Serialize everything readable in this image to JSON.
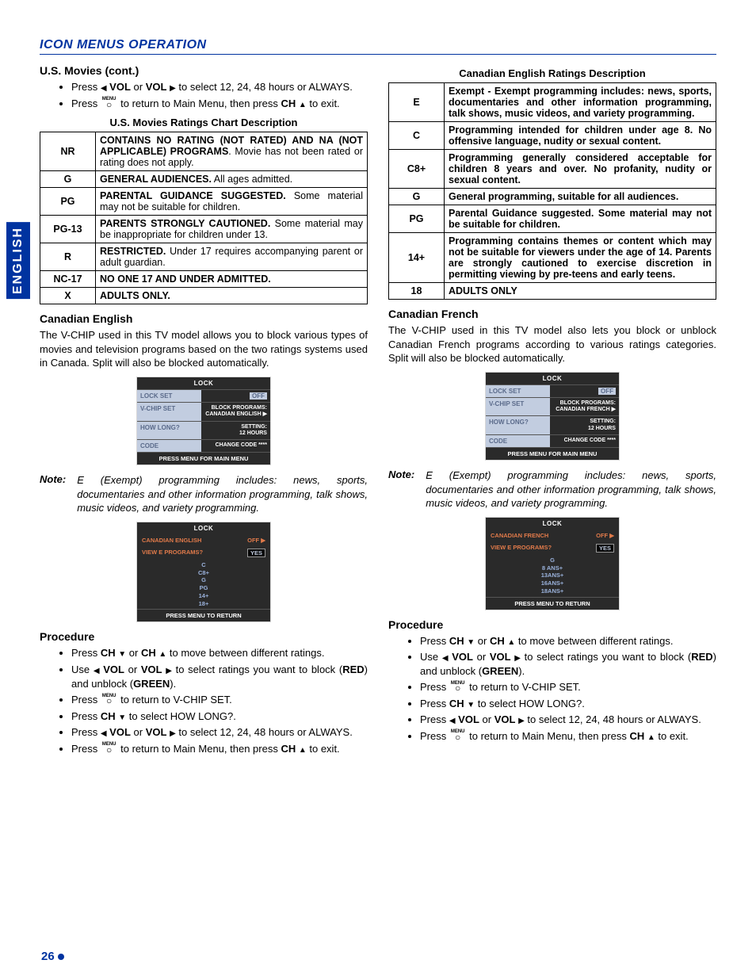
{
  "header": "ICON MENUS OPERATION",
  "side_tab": "ENGLISH",
  "page_number": "26",
  "left": {
    "us_movies_cont": "U.S. Movies (cont.)",
    "bullets_top": [
      "Press ◀ VOL or VOL ▶ to select 12, 24, 48 hours or ALWAYS.",
      "Press [MENU] to return to Main Menu, then press CH ▲ to exit."
    ],
    "chart_title": "U.S. Movies Ratings Chart Description",
    "us_table": [
      {
        "code": "NR",
        "desc": "CONTAINS NO RATING (NOT RATED) AND NA (NOT APPLICABLE) PROGRAMS. Movie has not been rated or rating does not apply.",
        "bold_prefix": "CONTAINS NO RATING (NOT RATED) AND NA (NOT APPLICABLE) PROGRAMS"
      },
      {
        "code": "G",
        "desc": "GENERAL AUDIENCES. All ages admitted.",
        "bold_prefix": "GENERAL AUDIENCES."
      },
      {
        "code": "PG",
        "desc": "PARENTAL GUIDANCE SUGGESTED. Some material may not be suitable for children.",
        "bold_prefix": "PARENTAL GUIDANCE SUGGESTED."
      },
      {
        "code": "PG-13",
        "desc": "PARENTS STRONGLY CAUTIONED. Some material may be inappropriate for children under 13.",
        "bold_prefix": "PARENTS STRONGLY CAUTIONED."
      },
      {
        "code": "R",
        "desc": "RESTRICTED. Under 17 requires accompanying parent or adult guardian.",
        "bold_prefix": "RESTRICTED."
      },
      {
        "code": "NC-17",
        "desc": "NO ONE 17 AND UNDER ADMITTED.",
        "bold_prefix": "NO ONE 17 AND UNDER ADMITTED."
      },
      {
        "code": "X",
        "desc": "ADULTS ONLY.",
        "bold_prefix": "ADULTS ONLY."
      }
    ],
    "can_en_head": "Canadian English",
    "can_en_body": "The V-CHIP used in this TV model allows you to block various types of movies and television programs based on the two ratings systems used in Canada. Split will also be blocked automatically.",
    "osd1": {
      "title": "LOCK",
      "rows": [
        {
          "left": "LOCK SET",
          "right_chip": "OFF"
        },
        {
          "left": "V-CHIP SET",
          "right_lines": [
            "BLOCK PROGRAMS:",
            "CANADIAN ENGLISH ▶"
          ]
        },
        {
          "left": "HOW LONG?",
          "right_lines": [
            "SETTING:",
            "12 HOURS"
          ]
        },
        {
          "left": "CODE",
          "right_lines": [
            "CHANGE CODE  ****"
          ]
        }
      ],
      "footer": "PRESS MENU FOR MAIN MENU"
    },
    "note_label": "Note:",
    "note_text": "E (Exempt) programming includes: news, sports, documentaries and other information programming, talk shows, music videos, and variety programming.",
    "osd2": {
      "title": "LOCK",
      "headrow": {
        "left": "CANADIAN ENGLISH",
        "right": "OFF ▶"
      },
      "row_q": {
        "left": "VIEW E PROGRAMS?",
        "right_chip": "YES"
      },
      "list": [
        "C",
        "C8+",
        "G",
        "PG",
        "14+",
        "18+"
      ],
      "footer": "PRESS MENU TO RETURN"
    },
    "proc_head": "Procedure",
    "procedure": [
      "Press CH ▼ or CH ▲ to move between different ratings.",
      "Use ◀ VOL or VOL ▶ to select ratings you want to block (RED) and unblock (GREEN).",
      "Press [MENU] to return to V-CHIP SET.",
      "Press CH ▼ to select HOW LONG?.",
      "Press ◀ VOL or VOL ▶ to select 12, 24, 48 hours or ALWAYS.",
      "Press [MENU] to return to Main Menu, then press CH ▲ to exit."
    ]
  },
  "right": {
    "can_table_title": "Canadian English Ratings Description",
    "can_table": [
      {
        "code": "E",
        "desc": "Exempt - Exempt programming includes: news, sports, documentaries and other information programming, talk shows, music videos, and variety programming."
      },
      {
        "code": "C",
        "desc": "Programming intended for children under age 8. No offensive language, nudity or sexual content."
      },
      {
        "code": "C8+",
        "desc": "Programming generally considered acceptable for children 8 years and over. No profanity, nudity or sexual content."
      },
      {
        "code": "G",
        "desc": "General programming, suitable for all audiences."
      },
      {
        "code": "PG",
        "desc": "Parental Guidance suggested. Some material may not be suitable for children."
      },
      {
        "code": "14+",
        "desc": "Programming contains themes or content which may not be suitable for viewers under the age of 14. Parents are strongly cautioned to exercise discretion in permitting viewing by pre-teens and early teens."
      },
      {
        "code": "18",
        "desc": "ADULTS ONLY"
      }
    ],
    "can_fr_head": "Canadian French",
    "can_fr_body": "The V-CHIP used in this TV model also lets you block or unblock Canadian French programs according to various ratings categories. Split will also be blocked automatically.",
    "osd1": {
      "title": "LOCK",
      "rows": [
        {
          "left": "LOCK SET",
          "right_chip": "OFF"
        },
        {
          "left": "V-CHIP SET",
          "right_lines": [
            "BLOCK PROGRAMS:",
            "CANADIAN FRENCH ▶"
          ]
        },
        {
          "left": "HOW LONG?",
          "right_lines": [
            "SETTING:",
            "12 HOURS"
          ]
        },
        {
          "left": "CODE",
          "right_lines": [
            "CHANGE CODE  ****"
          ]
        }
      ],
      "footer": "PRESS MENU FOR MAIN MENU"
    },
    "note_label": "Note:",
    "note_text": "E (Exempt) programming includes: news, sports, documentaries and other information programming, talk shows, music videos, and variety programming.",
    "osd2": {
      "title": "LOCK",
      "headrow": {
        "left": "CANADIAN FRENCH",
        "right": "OFF ▶"
      },
      "row_q": {
        "left": "VIEW E PROGRAMS?",
        "right_chip": "YES"
      },
      "list": [
        "G",
        "8  ANS+",
        "13ANS+",
        "16ANS+",
        "18ANS+"
      ],
      "footer": "PRESS MENU TO RETURN"
    },
    "proc_head": "Procedure",
    "procedure": [
      "Press CH ▼ or CH ▲ to move between different ratings.",
      "Use ◀ VOL or VOL ▶ to select ratings you want to block (RED) and unblock (GREEN).",
      "Press [MENU] to return to V-CHIP SET.",
      "Press CH ▼ to select HOW LONG?.",
      "Press ◀ VOL or VOL ▶ to select 12, 24, 48 hours or ALWAYS.",
      "Press [MENU] to return to Main Menu, then press CH ▲ to exit."
    ]
  }
}
